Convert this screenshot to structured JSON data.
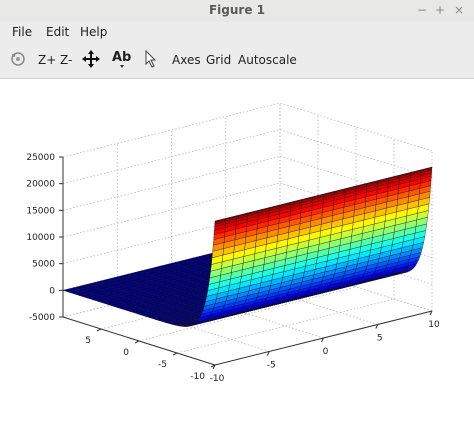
{
  "window": {
    "title": "Figure 1",
    "controls": [
      "−",
      "+",
      "×"
    ]
  },
  "menu": {
    "file": "File",
    "edit": "Edit",
    "help": "Help"
  },
  "toolbar": {
    "zoom_in": "Z+",
    "zoom_out": "Z-",
    "text_tool": "Ab",
    "axes": "Axes",
    "grid": "Grid",
    "autoscale": "Autoscale"
  },
  "chart_data": {
    "type": "surface",
    "title": "",
    "xlabel": "",
    "ylabel": "",
    "zlabel": "",
    "x_range": [
      -10,
      10
    ],
    "y_range": [
      -10,
      10
    ],
    "zlim": [
      -5000,
      25000
    ],
    "x_ticks": [
      "-10",
      "-5",
      "0",
      "5",
      "10"
    ],
    "y_ticks": [
      "-10",
      "-5",
      "0",
      "5"
    ],
    "z_ticks": [
      "25000",
      "20000",
      "15000",
      "10000",
      "5000",
      "0",
      "-5000"
    ],
    "colormap": "jet",
    "grid": true,
    "surface_profile": {
      "description_axis": "y",
      "y": [
        -10,
        -9,
        -8,
        -7,
        -6,
        -5,
        -4,
        -3,
        -2,
        0,
        10
      ],
      "z": [
        22000,
        8100,
        3000,
        1100,
        400,
        150,
        55,
        20,
        7,
        1,
        0
      ]
    }
  }
}
